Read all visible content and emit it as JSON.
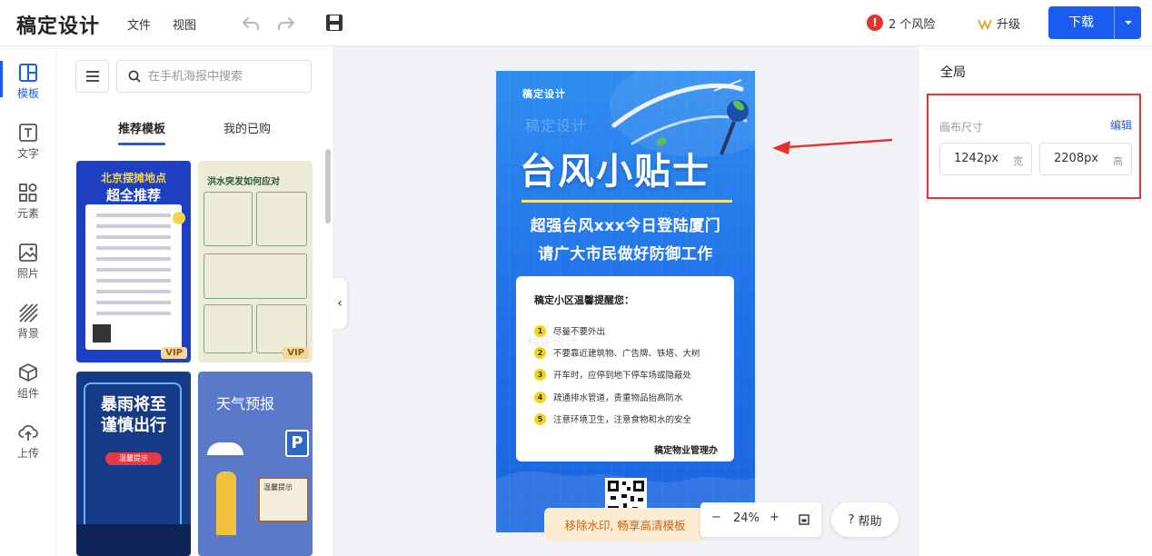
{
  "app": {
    "brand": "稿定设计"
  },
  "topbar": {
    "menu": [
      "文件",
      "视图"
    ],
    "risk_count": "!",
    "risk_label": "2 个风险",
    "upgrade_label": "升级",
    "download_label": "下载"
  },
  "rail": {
    "items": [
      {
        "label": "模板",
        "icon": "template-icon"
      },
      {
        "label": "文字",
        "icon": "text-icon"
      },
      {
        "label": "元素",
        "icon": "elements-icon"
      },
      {
        "label": "照片",
        "icon": "photo-icon"
      },
      {
        "label": "背景",
        "icon": "background-icon"
      },
      {
        "label": "组件",
        "icon": "component-icon"
      },
      {
        "label": "上传",
        "icon": "upload-icon"
      }
    ]
  },
  "panel": {
    "search_placeholder": "在手机海报中搜索",
    "tabs": [
      "推荐模板",
      "我的已购"
    ],
    "cards": [
      {
        "title_line1": "北京摆摊地点",
        "title_line2": "超全推荐",
        "badge": "VIP"
      },
      {
        "title": "洪水突发如何应对",
        "badge": "VIP"
      },
      {
        "title_line1": "暴雨将至",
        "title_line2": "谨慎出行",
        "button": "温馨提示"
      },
      {
        "title": "天气预报",
        "sign": "温馨提示",
        "parking": "P"
      }
    ]
  },
  "poster": {
    "brand": "稿定设计",
    "watermark": "稿定设计",
    "title": "台风小贴士",
    "subtitle_1": "超强台风xxx今日登陆厦门",
    "subtitle_2": "请广大市民做好防御工作",
    "card": {
      "heading": "稿定小区温馨提醒您：",
      "items": [
        {
          "num": "1",
          "text": "尽量不要外出"
        },
        {
          "num": "2",
          "text": "不要靠近建筑物、广告牌、铁塔、大树"
        },
        {
          "num": "3",
          "text": "开车时，应停到地下停车场或隐蔽处"
        },
        {
          "num": "4",
          "text": "疏通排水管道，贵重物品抬高防水"
        },
        {
          "num": "5",
          "text": "注意环境卫生，注意食物和水的安全"
        }
      ],
      "signature": "稿定物业管理办",
      "watermark": "稿定设计"
    }
  },
  "canvas": {
    "watermark_button": "移除水印, 畅享高清模板",
    "zoom_minus": "−",
    "zoom_level": "24%",
    "zoom_plus": "+",
    "help_label": "帮助"
  },
  "right_panel": {
    "title": "全局",
    "canvas_size_label": "画布尺寸",
    "edit_label": "编辑",
    "width_value": "1242px",
    "width_unit": "宽",
    "height_value": "2208px",
    "height_unit": "高"
  },
  "colors": {
    "accent": "#1a5cf0",
    "highlight": "#e8302e",
    "poster_blue": "#1e6fe8"
  }
}
